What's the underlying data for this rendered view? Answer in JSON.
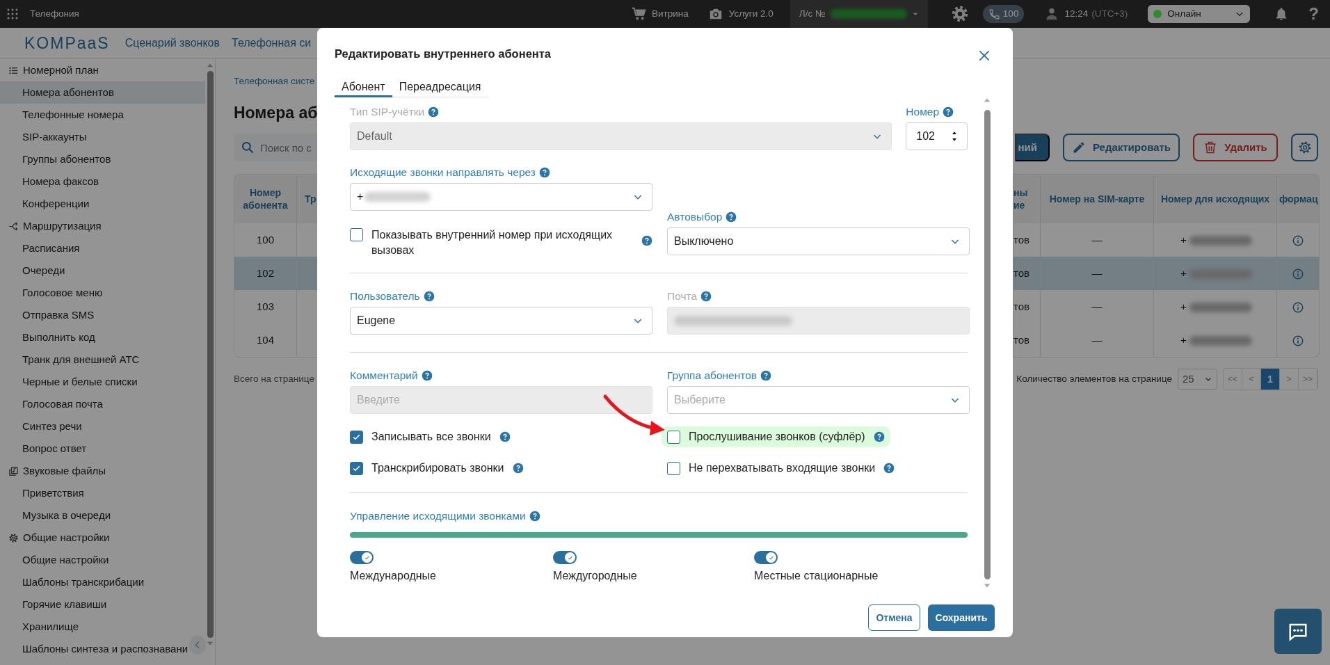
{
  "top_bar": {
    "app_title": "Телефония",
    "showcase": "Витрина",
    "services": "Услуги 2.0",
    "account_label": "Л/с №",
    "calls_count": "100",
    "time": "12:24",
    "timezone": "(UTC+3)",
    "status": {
      "label": "Онлайн",
      "color": "#2f8a33"
    },
    "help": "?"
  },
  "nav": {
    "logo": "KOMPaaS",
    "links": [
      "Сценарий звонков",
      "Телефонная си"
    ]
  },
  "sidebar": {
    "groups": [
      {
        "title": "Номерной план",
        "items": [
          {
            "label": "Номера абонентов",
            "selected": true
          },
          {
            "label": "Телефонные номера",
            "selected": false
          },
          {
            "label": "SIP-аккаунты",
            "selected": false
          },
          {
            "label": "Группы абонентов",
            "selected": false
          },
          {
            "label": "Номера факсов",
            "selected": false
          },
          {
            "label": "Конференции",
            "selected": false
          }
        ]
      },
      {
        "title": "Маршрутизация",
        "items": [
          {
            "label": "Расписания",
            "selected": false
          },
          {
            "label": "Очереди",
            "selected": false
          },
          {
            "label": "Голосовое меню",
            "selected": false
          },
          {
            "label": "Отправка SMS",
            "selected": false
          },
          {
            "label": "Выполнить код",
            "selected": false
          },
          {
            "label": "Транк для внешней АТС",
            "selected": false
          },
          {
            "label": "Черные и белые списки",
            "selected": false
          },
          {
            "label": "Голосовая почта",
            "selected": false
          },
          {
            "label": "Синтез речи",
            "selected": false
          },
          {
            "label": "Вопрос ответ",
            "selected": false
          }
        ]
      },
      {
        "title": "Звуковые файлы",
        "items": [
          {
            "label": "Приветствия",
            "selected": false
          },
          {
            "label": "Музыка в очереди",
            "selected": false
          }
        ]
      },
      {
        "title": "Общие настройки",
        "items": [
          {
            "label": "Общие настройки",
            "selected": false
          },
          {
            "label": "Шаблоны транскрибации",
            "selected": false
          },
          {
            "label": "Горячие клавиши",
            "selected": false
          },
          {
            "label": "Хранилище",
            "selected": false
          },
          {
            "label": "Шаблоны синтеза и распознавани",
            "selected": false
          }
        ]
      }
    ]
  },
  "page": {
    "breadcrumb": "Телефонная систе",
    "title": "Номера аб",
    "search": {
      "placeholder": "Поиск по с"
    },
    "actions": [
      {
        "kind": "primary",
        "label": "ний"
      },
      {
        "kind": "edit",
        "label": "Редактировать"
      },
      {
        "kind": "delete",
        "label": "Удалить"
      },
      {
        "kind": "settings"
      }
    ],
    "table": {
      "columns": [
        "Номер абонента",
        "Тр",
        "ны ие",
        "Номер на SIM-карте",
        "Номер для исходящих",
        "формац"
      ],
      "rows": [
        {
          "number": "100",
          "column_3": "тов",
          "sim": "—",
          "outgoing": "+",
          "selected": false
        },
        {
          "number": "102",
          "column_3": "тов",
          "sim": "—",
          "outgoing": "+",
          "selected": true
        },
        {
          "number": "103",
          "column_3": "тов",
          "sim": "—",
          "outgoing": "+",
          "selected": false
        },
        {
          "number": "104",
          "column_3": "тов",
          "sim": "—",
          "outgoing": "+",
          "selected": false
        }
      ]
    },
    "total": "Всего на странице",
    "page_size_label": "Количество элементов на странице",
    "page_size": "25",
    "pager": [
      {
        "label": "<<",
        "selected": false
      },
      {
        "label": "<",
        "selected": false
      },
      {
        "label": "1",
        "selected": true
      },
      {
        "label": ">",
        "selected": false
      },
      {
        "label": ">>",
        "selected": false
      }
    ]
  },
  "modal": {
    "title": "Редактировать внутреннего абонента",
    "tabs": [
      {
        "label": "Абонент",
        "selected": true
      },
      {
        "label": "Переадресация",
        "selected": false
      }
    ],
    "sip_type": {
      "label": "Тип SIP-учётки",
      "value": "Default",
      "disabled": true,
      "muted": true
    },
    "number": {
      "label": "Номер",
      "value": "102"
    },
    "outgoing_route": {
      "label": "Исходящие звонки направлять через",
      "value": "+"
    },
    "show_internal": {
      "label": "Показывать внутренний номер при исходящих вызовах",
      "checked": false
    },
    "autoselect": {
      "label": "Автовыбор",
      "value": "Выключено"
    },
    "user": {
      "label": "Пользователь",
      "value": "Eugene"
    },
    "email": {
      "label": "Почта",
      "disabled": true,
      "muted": true
    },
    "comment": {
      "label": "Комментарий",
      "placeholder": "Введите",
      "disabled": true
    },
    "group": {
      "label": "Группа абонентов",
      "placeholder": "Выберите"
    },
    "options": [
      {
        "label": "Записывать все звонки",
        "checked": true,
        "highlighted": false
      },
      {
        "label": "Прослушивание звонков (суфлёр)",
        "checked": false,
        "highlighted": true
      },
      {
        "label": "Транскрибировать звонки",
        "checked": true,
        "highlighted": false
      },
      {
        "label": "Не перехватывать входящие звонки",
        "checked": false,
        "highlighted": false
      }
    ],
    "outgoing_control": {
      "label": "Управление исходящими звонками",
      "switches": [
        {
          "label": "Международные",
          "on": true
        },
        {
          "label": "Междугородные",
          "on": true
        },
        {
          "label": "Местные стационарные",
          "on": true
        }
      ]
    },
    "cancel": "Отмена",
    "save": "Сохранить"
  }
}
